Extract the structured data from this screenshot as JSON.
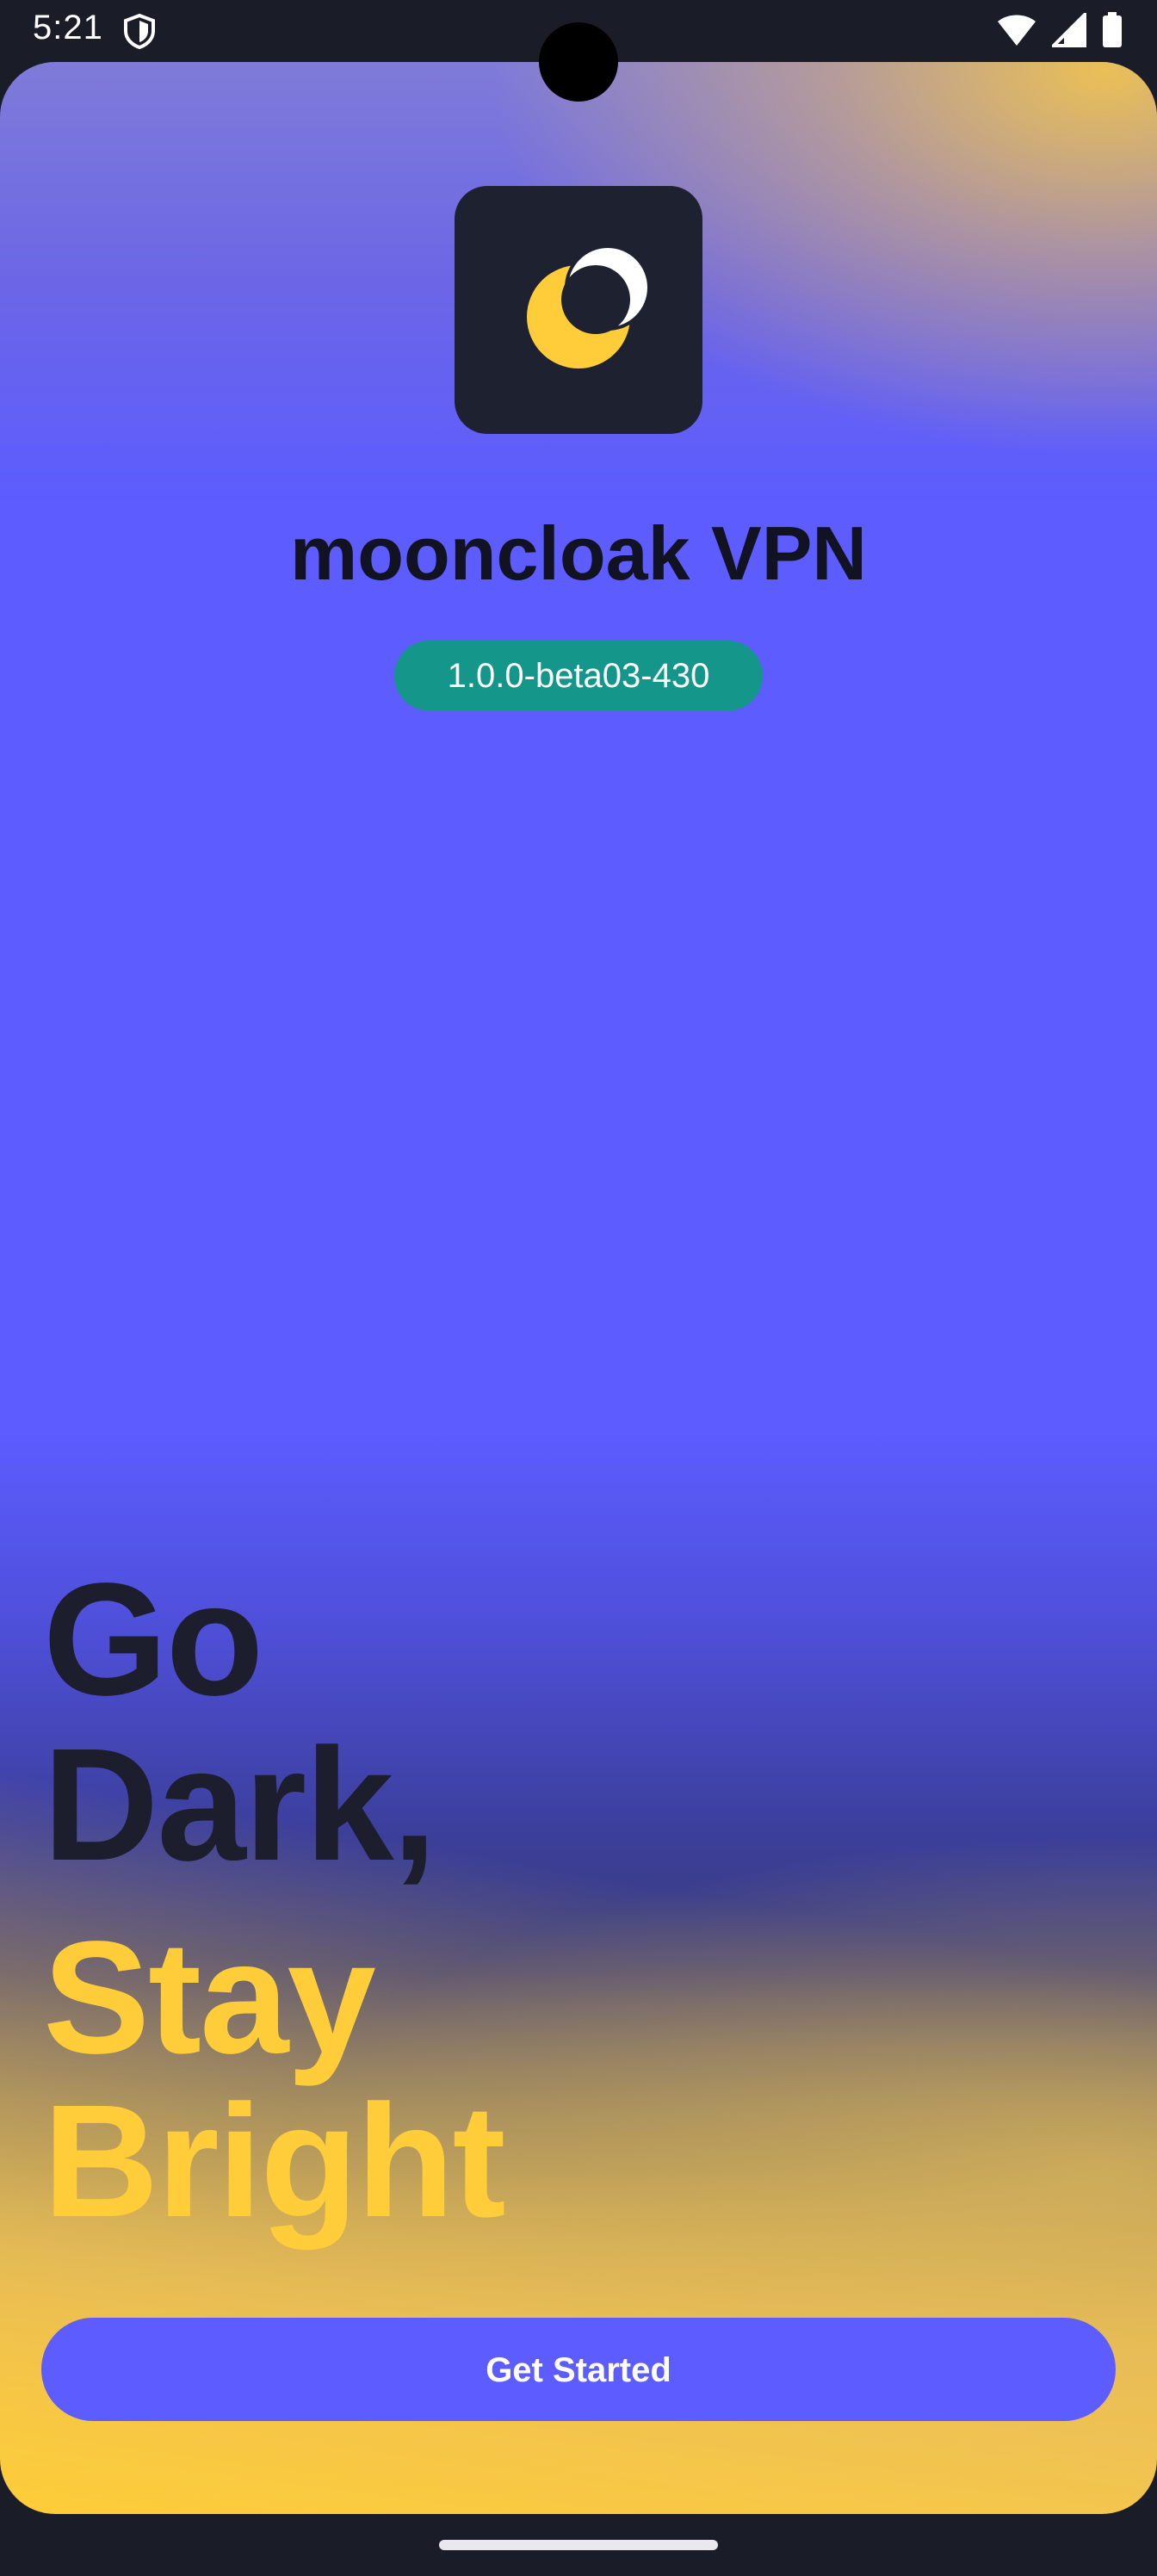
{
  "status_bar": {
    "time": "5:21",
    "icons": [
      "vpn-shield-icon",
      "wifi-icon",
      "signal-icon",
      "battery-icon"
    ]
  },
  "app": {
    "name": "mooncloak VPN",
    "version": "1.0.0-beta03-430",
    "logo": "moon-logo-icon"
  },
  "headline": {
    "line1": "Go",
    "line2": "Dark,",
    "line3": "Stay",
    "line4": "Bright"
  },
  "cta": {
    "label": "Get Started"
  },
  "colors": {
    "accent": "#5c5cff",
    "bright": "#ffcc3a",
    "badge": "#15968a",
    "dark": "#1c1e2e"
  }
}
